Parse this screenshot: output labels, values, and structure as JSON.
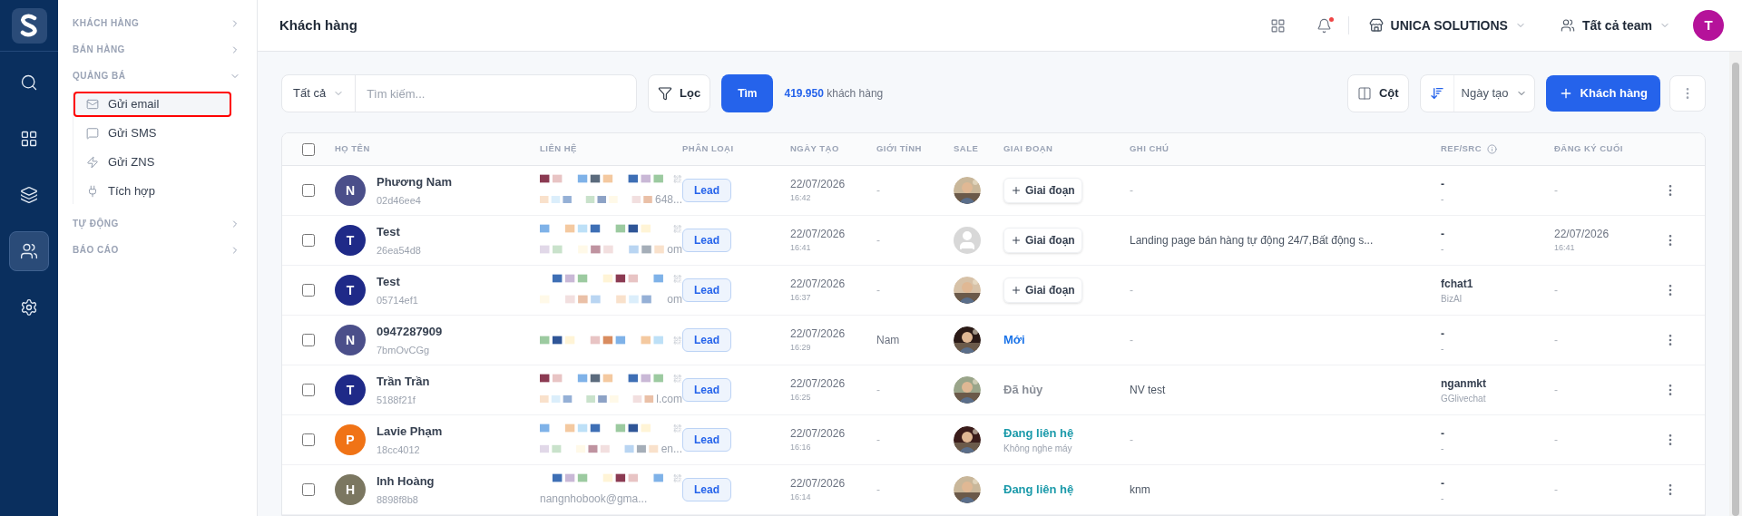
{
  "rail": {
    "items": [
      {
        "kind": "search",
        "selected": false
      },
      {
        "kind": "grid",
        "selected": false
      },
      {
        "kind": "layers",
        "selected": false
      },
      {
        "kind": "users",
        "selected": true
      },
      {
        "kind": "settings",
        "selected": false
      }
    ]
  },
  "sidebar": {
    "groups": [
      {
        "label": "KHÁCH HÀNG",
        "expanded": false
      },
      {
        "label": "BÁN HÀNG",
        "expanded": false
      },
      {
        "label": "QUẢNG BÁ",
        "expanded": true,
        "items": [
          {
            "label": "Gửi email",
            "kind": "mail",
            "selected": true
          },
          {
            "label": "Gửi SMS",
            "kind": "message",
            "selected": false
          },
          {
            "label": "Gửi ZNS",
            "kind": "zap",
            "selected": false
          },
          {
            "label": "Tích hợp",
            "kind": "plug",
            "selected": false
          }
        ]
      },
      {
        "label": "TỰ ĐỘNG",
        "expanded": false
      },
      {
        "label": "BÁO CÁO",
        "expanded": false
      }
    ]
  },
  "header": {
    "title": "Khách hàng",
    "notification_dot": true,
    "company": "UNICA SOLUTIONS",
    "team": "Tất cả team",
    "user_initial": "T"
  },
  "toolbar": {
    "scope": "Tất cả",
    "search_placeholder": "Tìm kiếm...",
    "filter": "Lọc",
    "search_button": "Tìm",
    "count": "419.950",
    "count_label": "khách hàng",
    "columns_button": "Cột",
    "sort": "Ngày tạo",
    "add_button": "Khách hàng"
  },
  "table": {
    "all_checked": false,
    "columns": [
      "HỌ TÊN",
      "LIÊN HỆ",
      "PHÂN LOẠI",
      "NGÀY TẠO",
      "GIỚI TÍNH",
      "SALE",
      "GIAI ĐOẠN",
      "GHI CHÚ",
      "REF/SRC",
      "ĐĂNG KÝ CUỐI"
    ],
    "rows": [
      {
        "checked": false,
        "initial": "N",
        "color": "#4b4f8a",
        "name": "Phương Nam",
        "code": "02d46ee4",
        "contact": {
          "kind": "redacted",
          "tail": "648..."
        },
        "type": "Lead",
        "date": "22/07/2026",
        "time": "16:42",
        "gender": "-",
        "stage": {
          "kind": "button",
          "label": "Giai đoạn"
        },
        "note": "-",
        "ref": "-",
        "src": "-",
        "last": {
          "date": "-"
        }
      },
      {
        "checked": false,
        "initial": "T",
        "color": "#1f2a88",
        "name": "Test",
        "code": "26ea54d8",
        "contact": {
          "kind": "redacted",
          "tail": "om"
        },
        "type": "Lead",
        "date": "22/07/2026",
        "time": "16:41",
        "gender": "-",
        "sale": {
          "kind": "placeholder"
        },
        "stage": {
          "kind": "button",
          "label": "Giai đoạn"
        },
        "note": "Landing page bán hàng tự động 24/7,Bất động s...",
        "ref": "-",
        "src": "-",
        "last": {
          "date": "22/07/2026",
          "time": "16:41"
        }
      },
      {
        "checked": false,
        "initial": "T",
        "color": "#1f2a88",
        "name": "Test",
        "code": "05714ef1",
        "contact": {
          "kind": "redacted",
          "tail": "om"
        },
        "type": "Lead",
        "date": "22/07/2026",
        "time": "16:37",
        "gender": "-",
        "stage": {
          "kind": "button",
          "label": "Giai đoạn"
        },
        "note": "-",
        "ref": "fchat1",
        "src": "BizAI",
        "last": {
          "date": "-"
        }
      },
      {
        "checked": false,
        "initial": "N",
        "color": "#4b4f8a",
        "name": "0947287909",
        "code": "7bmOvCGg",
        "contact": {
          "kind": "single"
        },
        "type": "Lead",
        "date": "22/07/2026",
        "time": "16:29",
        "gender": "Nam",
        "stage": {
          "kind": "status",
          "label": "Mới",
          "color": "#1a73e8"
        },
        "note": "-",
        "ref": "-",
        "src": "-",
        "last": {
          "date": "-"
        }
      },
      {
        "checked": false,
        "initial": "T",
        "color": "#1f2a88",
        "name": "Trần Trần",
        "code": "5188f21f",
        "contact": {
          "kind": "redacted",
          "tail": "l.com"
        },
        "type": "Lead",
        "date": "22/07/2026",
        "time": "16:25",
        "gender": "-",
        "stage": {
          "kind": "status",
          "label": "Đã hủy",
          "color": "#8a8f98"
        },
        "note": "NV test",
        "ref": "nganmkt",
        "src": "GGlivechat",
        "last": {
          "date": "-"
        }
      },
      {
        "checked": false,
        "initial": "P",
        "color": "#f07316",
        "name": "Lavie Phạm",
        "code": "18cc4012",
        "contact": {
          "kind": "redacted",
          "tail": "en..."
        },
        "type": "Lead",
        "date": "22/07/2026",
        "time": "16:16",
        "gender": "-",
        "stage": {
          "kind": "status",
          "label": "Đang liên hệ",
          "color": "#1b9aaa",
          "sub": "Không nghe máy"
        },
        "note": "-",
        "ref": "-",
        "src": "-",
        "last": {
          "date": "-"
        }
      },
      {
        "checked": false,
        "initial": "H",
        "color": "#7b7761",
        "name": "Inh Hoàng",
        "code": "8898f8b8",
        "contact": {
          "kind": "plain",
          "tail": "nangnhobook@gma..."
        },
        "type": "Lead",
        "date": "22/07/2026",
        "time": "16:14",
        "gender": "-",
        "stage": {
          "kind": "status",
          "label": "Đang liên hệ",
          "color": "#1b9aaa"
        },
        "note": "knm",
        "ref": "-",
        "src": "-",
        "last": {
          "date": "-"
        }
      }
    ]
  }
}
